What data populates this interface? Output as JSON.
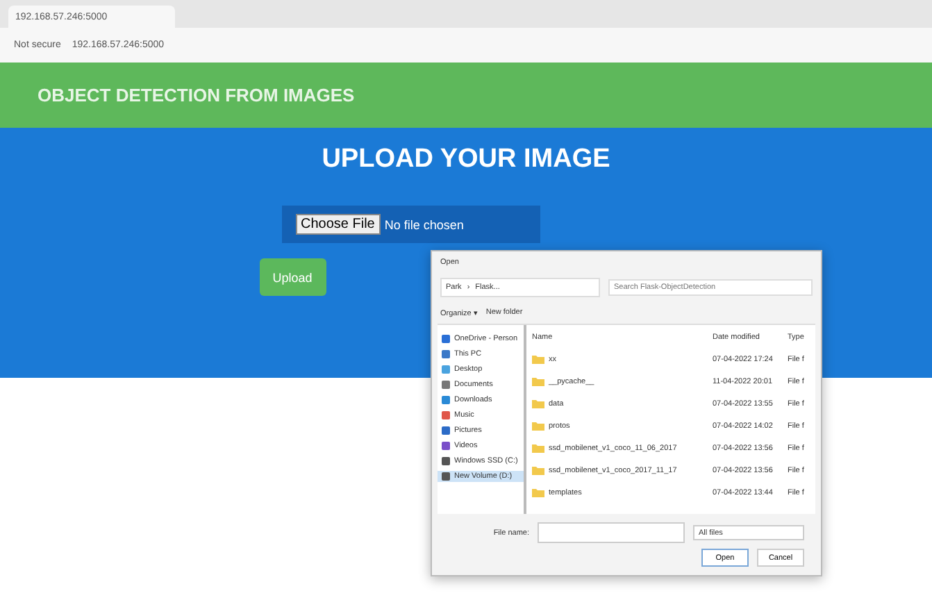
{
  "browser": {
    "tab_title": "192.168.57.246:5000",
    "security": "Not secure",
    "address": "192.168.57.246:5000"
  },
  "navbar": {
    "brand": "OBJECT DETECTION FROM IMAGES"
  },
  "hero": {
    "title": "UPLOAD YOUR IMAGE",
    "file_button": "Choose File",
    "file_status": "No file chosen",
    "upload": "Upload"
  },
  "dialog": {
    "title": "Open",
    "path": [
      "Park",
      "›",
      "Flask..."
    ],
    "search": {
      "placeholder": "Search Flask-ObjectDetection"
    },
    "organize": "Organize ▾",
    "new_folder": "New folder",
    "sidebar": [
      {
        "label": "OneDrive - Person",
        "kind": "cloud",
        "selected": false
      },
      {
        "label": "This PC",
        "kind": "pc",
        "selected": false
      },
      {
        "label": "Desktop",
        "kind": "desktop",
        "selected": false
      },
      {
        "label": "Documents",
        "kind": "docs",
        "selected": false
      },
      {
        "label": "Downloads",
        "kind": "down",
        "selected": false
      },
      {
        "label": "Music",
        "kind": "music",
        "selected": false
      },
      {
        "label": "Pictures",
        "kind": "pics",
        "selected": false
      },
      {
        "label": "Videos",
        "kind": "video",
        "selected": false
      },
      {
        "label": "Windows SSD (C:)",
        "kind": "drive",
        "selected": false
      },
      {
        "label": "New Volume (D:)",
        "kind": "drive",
        "selected": true
      }
    ],
    "columns": [
      "Name",
      "Date modified",
      "Type"
    ],
    "files": [
      {
        "name": "xx",
        "date": "07-04-2022 17:24",
        "type": "File f"
      },
      {
        "name": "__pycache__",
        "date": "11-04-2022 20:01",
        "type": "File f"
      },
      {
        "name": "data",
        "date": "07-04-2022 13:55",
        "type": "File f"
      },
      {
        "name": "protos",
        "date": "07-04-2022 14:02",
        "type": "File f"
      },
      {
        "name": "ssd_mobilenet_v1_coco_11_06_2017",
        "date": "07-04-2022 13:56",
        "type": "File f"
      },
      {
        "name": "ssd_mobilenet_v1_coco_2017_11_17",
        "date": "07-04-2022 13:56",
        "type": "File f"
      },
      {
        "name": "templates",
        "date": "07-04-2022 13:44",
        "type": "File f"
      }
    ],
    "file_name_label": "File name:",
    "file_type": "All files",
    "open": "Open",
    "cancel": "Cancel"
  }
}
